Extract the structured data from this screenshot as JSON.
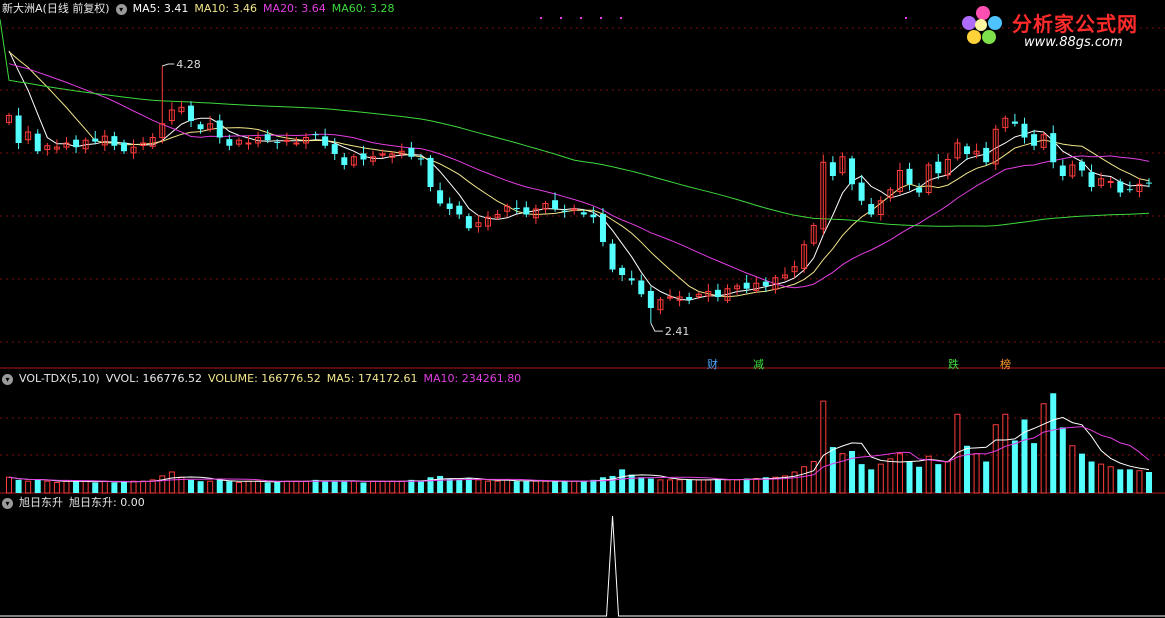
{
  "main_header": {
    "title": "新大洲A(日线 前复权)",
    "ma5": "MA5: 3.41",
    "ma10": "MA10: 3.46",
    "ma20": "MA20: 3.64",
    "ma60": "MA60: 3.28"
  },
  "vol_header": {
    "name": "VOL-TDX(5,10)",
    "vvol": "VVOL: 166776.52",
    "volume": "VOLUME: 166776.52",
    "ma5": "MA5: 174172.61",
    "ma10": "MA10: 234261.80"
  },
  "ind_header": {
    "name": "旭日东升",
    "value": "旭日东升: 0.00"
  },
  "annotations": {
    "high": "4.28",
    "low": "2.41"
  },
  "event_labels": [
    {
      "text": "财",
      "color": "#4aa8ff"
    },
    {
      "text": "减",
      "color": "#40e040"
    },
    {
      "text": "跌",
      "color": "#40e040"
    },
    {
      "text": "榜",
      "color": "#ff9a2e"
    }
  ],
  "logo": {
    "title": "分析家公式网",
    "url": "www.88gs.com"
  },
  "colors": {
    "up": "#ff3c3c",
    "down": "#54ffff",
    "ma5": "#ffffff",
    "ma10": "#f2e68a",
    "ma20": "#e23ee2",
    "ma60": "#3dd93d"
  },
  "chart_data": [
    {
      "type": "candlestick",
      "title": "新大洲A(日线 前复权)",
      "price_range": [
        2.2,
        4.6
      ],
      "high_label": 4.28,
      "low_label": 2.41,
      "ma_last": {
        "MA5": 3.41,
        "MA10": 3.46,
        "MA20": 3.64,
        "MA60": 3.28
      },
      "closes": [
        3.92,
        3.72,
        3.8,
        3.66,
        3.7,
        3.69,
        3.72,
        3.69,
        3.74,
        3.73,
        3.77,
        3.7,
        3.66,
        3.69,
        3.72,
        3.76,
        3.86,
        3.96,
        3.98,
        3.88,
        3.82,
        3.86,
        3.76,
        3.7,
        3.74,
        3.72,
        3.76,
        3.74,
        3.72,
        3.74,
        3.72,
        3.76,
        3.78,
        3.7,
        3.64,
        3.56,
        3.62,
        3.6,
        3.62,
        3.64,
        3.64,
        3.66,
        3.62,
        3.6,
        3.4,
        3.28,
        3.24,
        3.2,
        3.1,
        3.14,
        3.18,
        3.2,
        3.26,
        3.24,
        3.2,
        3.24,
        3.28,
        3.24,
        3.22,
        3.24,
        3.2,
        3.18,
        3.0,
        2.8,
        2.76,
        2.72,
        2.62,
        2.52,
        2.58,
        2.6,
        2.6,
        2.58,
        2.62,
        2.64,
        2.6,
        2.66,
        2.68,
        2.66,
        2.7,
        2.68,
        2.74,
        2.76,
        2.82,
        2.98,
        3.12,
        3.58,
        3.48,
        3.62,
        3.42,
        3.3,
        3.2,
        3.3,
        3.38,
        3.52,
        3.42,
        3.36,
        3.56,
        3.5,
        3.6,
        3.72,
        3.64,
        3.66,
        3.58,
        3.82,
        3.9,
        3.86,
        3.76,
        3.7,
        3.78,
        3.58,
        3.48,
        3.56,
        3.52,
        3.4,
        3.46,
        3.44,
        3.36,
        3.38,
        3.42,
        3.43
      ],
      "volume": {
        "vvol": 166776.52,
        "ma5": 174172.61,
        "ma10": 234261.8,
        "values": [
          12,
          10,
          9,
          10,
          9,
          8,
          9,
          9,
          9,
          8,
          9,
          8,
          9,
          9,
          9,
          10,
          13,
          16,
          12,
          10,
          9,
          9,
          10,
          9,
          8,
          9,
          9,
          8,
          9,
          9,
          9,
          9,
          10,
          9,
          9,
          9,
          9,
          8,
          9,
          9,
          9,
          9,
          10,
          9,
          12,
          13,
          11,
          10,
          11,
          10,
          9,
          9,
          10,
          9,
          9,
          9,
          9,
          9,
          9,
          9,
          9,
          10,
          12,
          13,
          18,
          14,
          12,
          11,
          10,
          10,
          10,
          10,
          10,
          10,
          11,
          10,
          10,
          11,
          11,
          12,
          12,
          13,
          16,
          20,
          24,
          70,
          35,
          30,
          32,
          22,
          18,
          22,
          26,
          30,
          24,
          20,
          28,
          22,
          24,
          60,
          36,
          30,
          24,
          52,
          60,
          40,
          56,
          38,
          68,
          76,
          50,
          36,
          30,
          24,
          22,
          20,
          18,
          18,
          17,
          16
        ]
      },
      "indicator": {
        "name": "旭日东升",
        "value": 0.0,
        "spike_index": 63
      }
    }
  ]
}
